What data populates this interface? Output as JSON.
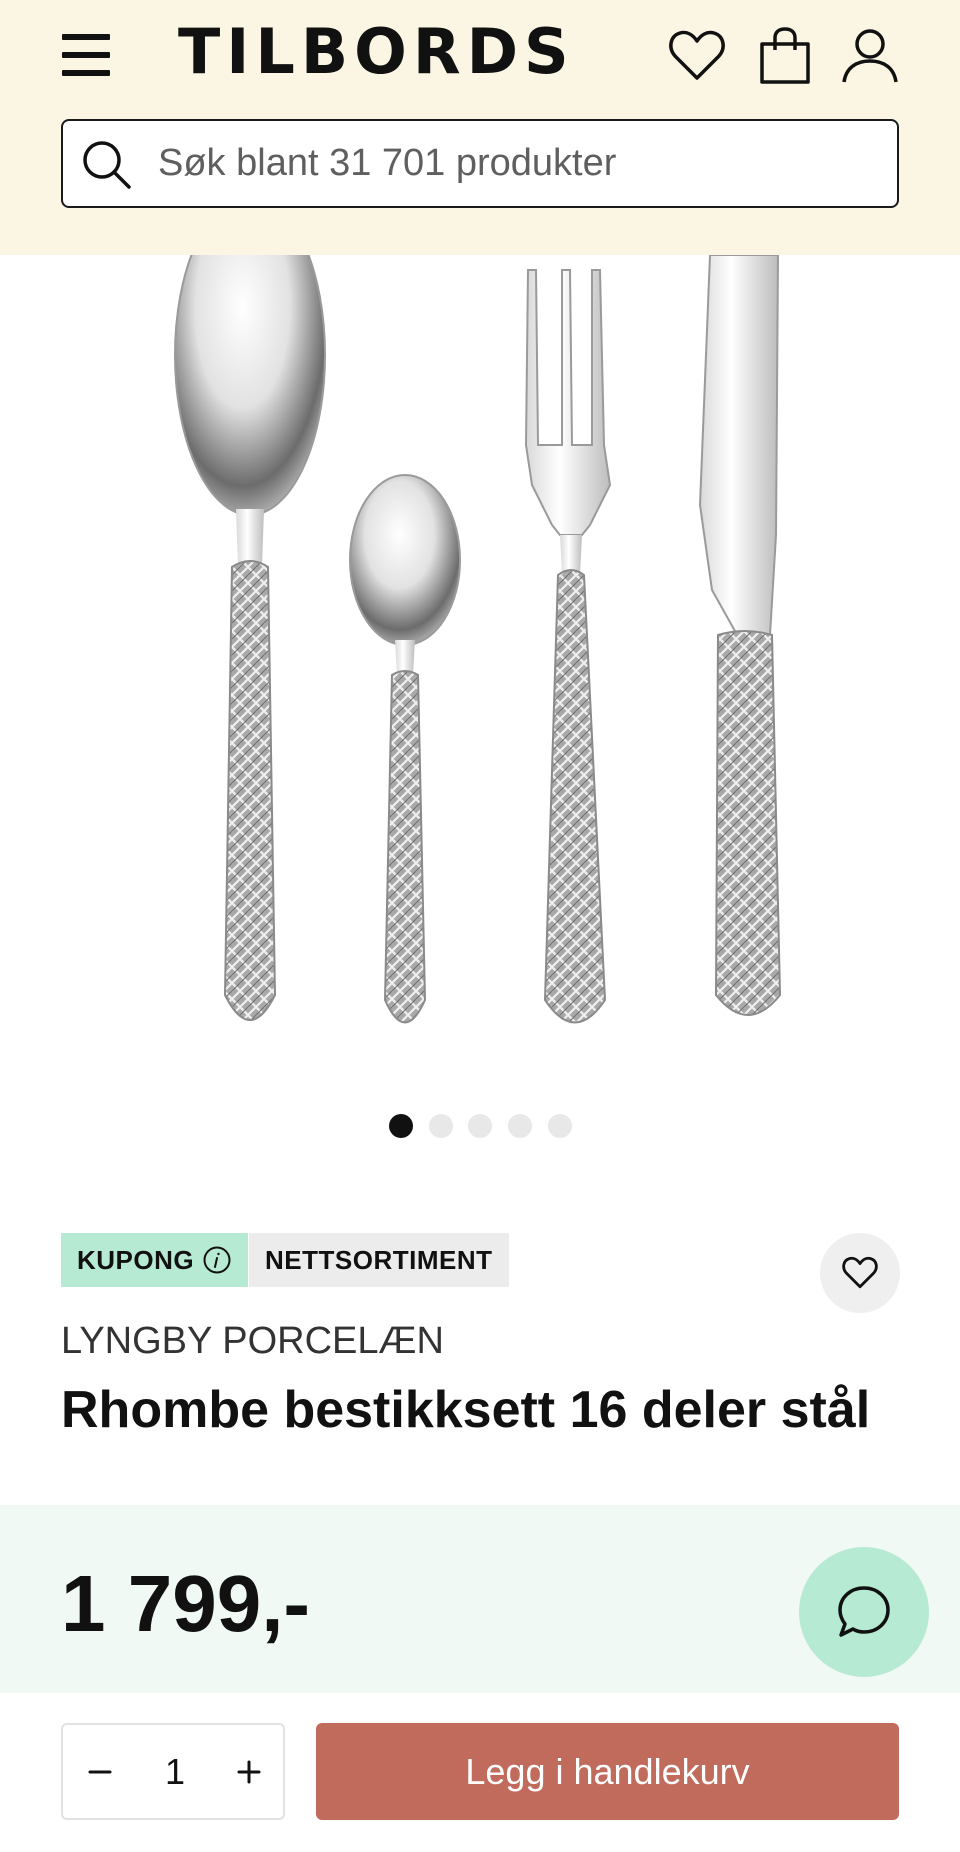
{
  "header": {
    "logo": "TILBORDS",
    "icons": [
      "menu-icon",
      "heart-icon",
      "shopping-bag-icon",
      "user-icon"
    ],
    "search": {
      "placeholder": "Søk blant 31 701 produkter"
    }
  },
  "gallery": {
    "image_count": 5,
    "active_index": 0
  },
  "product": {
    "badges": {
      "coupon": "KUPONG",
      "assortment": "NETTSORTIMENT"
    },
    "brand": "LYNGBY PORCELÆN",
    "title": "Rhombe bestikksett 16 deler stål",
    "price": "1 799,-"
  },
  "purchase": {
    "quantity": "1",
    "add_to_cart_label": "Legg i handlekurv"
  },
  "colors": {
    "header_bg": "#fbf6e3",
    "coupon_badge": "#b7ead2",
    "price_band": "#f1f9f4",
    "add_to_cart": "#c16b5d"
  }
}
